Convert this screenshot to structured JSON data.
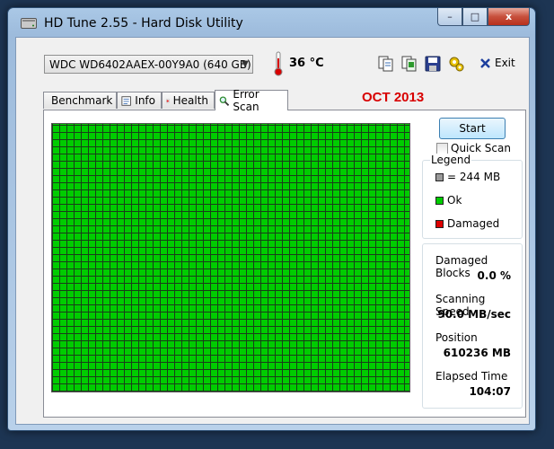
{
  "window": {
    "title": "HD Tune 2.55 - Hard Disk Utility"
  },
  "caption": {
    "minimize": "–",
    "maximize": "□",
    "close": "x"
  },
  "toolbar": {
    "drive": "WDC WD6402AAEX-00Y9A0 (640 GB)",
    "temperature": "36 °C",
    "exit_label": "Exit"
  },
  "tabs": [
    {
      "label": "Benchmark",
      "icon": "benchmark-icon"
    },
    {
      "label": "Info",
      "icon": "info-icon"
    },
    {
      "label": "Health",
      "icon": "health-icon"
    },
    {
      "label": "Error Scan",
      "icon": "magnifier-icon",
      "active": true
    }
  ],
  "annotation": "OCT 2013",
  "scan": {
    "start_label": "Start",
    "quick_scan_label": "Quick Scan",
    "quick_scan_checked": false,
    "block_color": "#00cc00"
  },
  "legend": {
    "title": "Legend",
    "block_size": "= 244 MB",
    "ok": "Ok",
    "damaged": "Damaged",
    "colors": {
      "block": "#9a9a9a",
      "ok": "#00cc00",
      "damaged": "#dd0000"
    }
  },
  "stats": {
    "damaged_blocks_label": "Damaged Blocks",
    "damaged_blocks_value": "0.0 %",
    "scanning_speed_label": "Scanning Speed",
    "scanning_speed_value": "90.0 MB/sec",
    "position_label": "Position",
    "position_value": "610236 MB",
    "elapsed_time_label": "Elapsed Time",
    "elapsed_time_value": "104:07"
  }
}
